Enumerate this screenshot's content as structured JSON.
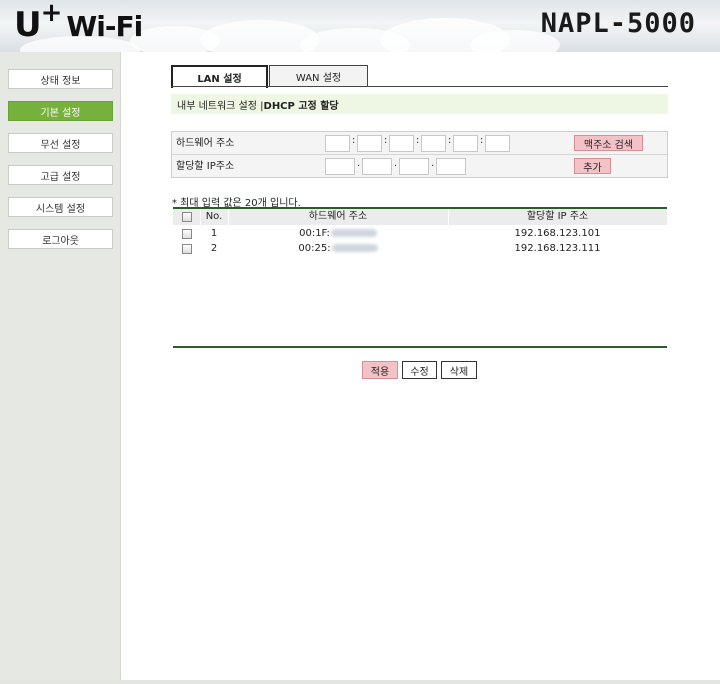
{
  "header": {
    "logo_u": "U",
    "logo_plus": "+",
    "logo_wifi": "Wi-Fi",
    "model": "NAPL-5000"
  },
  "sidebar": {
    "items": [
      {
        "label": "상태 정보",
        "active": false
      },
      {
        "label": "기본 설정",
        "active": true
      },
      {
        "label": "무선 설정",
        "active": false
      },
      {
        "label": "고급 설정",
        "active": false
      },
      {
        "label": "시스템 설정",
        "active": false
      },
      {
        "label": "로그아웃",
        "active": false
      }
    ]
  },
  "tabs": [
    {
      "label": "LAN 설정",
      "active": true
    },
    {
      "label": "WAN 설정",
      "active": false
    }
  ],
  "section": {
    "path": "내부 네트워크 설정 | ",
    "current": "DHCP 고정 할당"
  },
  "form": {
    "mac_label": "하드웨어 주소",
    "ip_label": "할당할 IP주소",
    "mac_sep": ":",
    "ip_sep": ".",
    "mac_search_button": "맥주소 검색",
    "add_button": "추가"
  },
  "note": "* 최대 입력 값은 20개 입니다.",
  "table": {
    "headers": {
      "no": "No.",
      "mac": "하드웨어 주소",
      "ip": "할당할 IP 주소"
    },
    "rows": [
      {
        "no": "1",
        "mac_prefix": "00:1F:",
        "ip": "192.168.123.101"
      },
      {
        "no": "2",
        "mac_prefix": "00:25:",
        "ip": "192.168.123.111"
      }
    ]
  },
  "actions": {
    "apply": "적용",
    "edit": "수정",
    "delete": "삭제"
  },
  "colors": {
    "accent_green": "#76b13c",
    "button_pink": "#f3c2c6",
    "section_bg": "#eef6e4",
    "table_line": "#2b5a2b"
  }
}
